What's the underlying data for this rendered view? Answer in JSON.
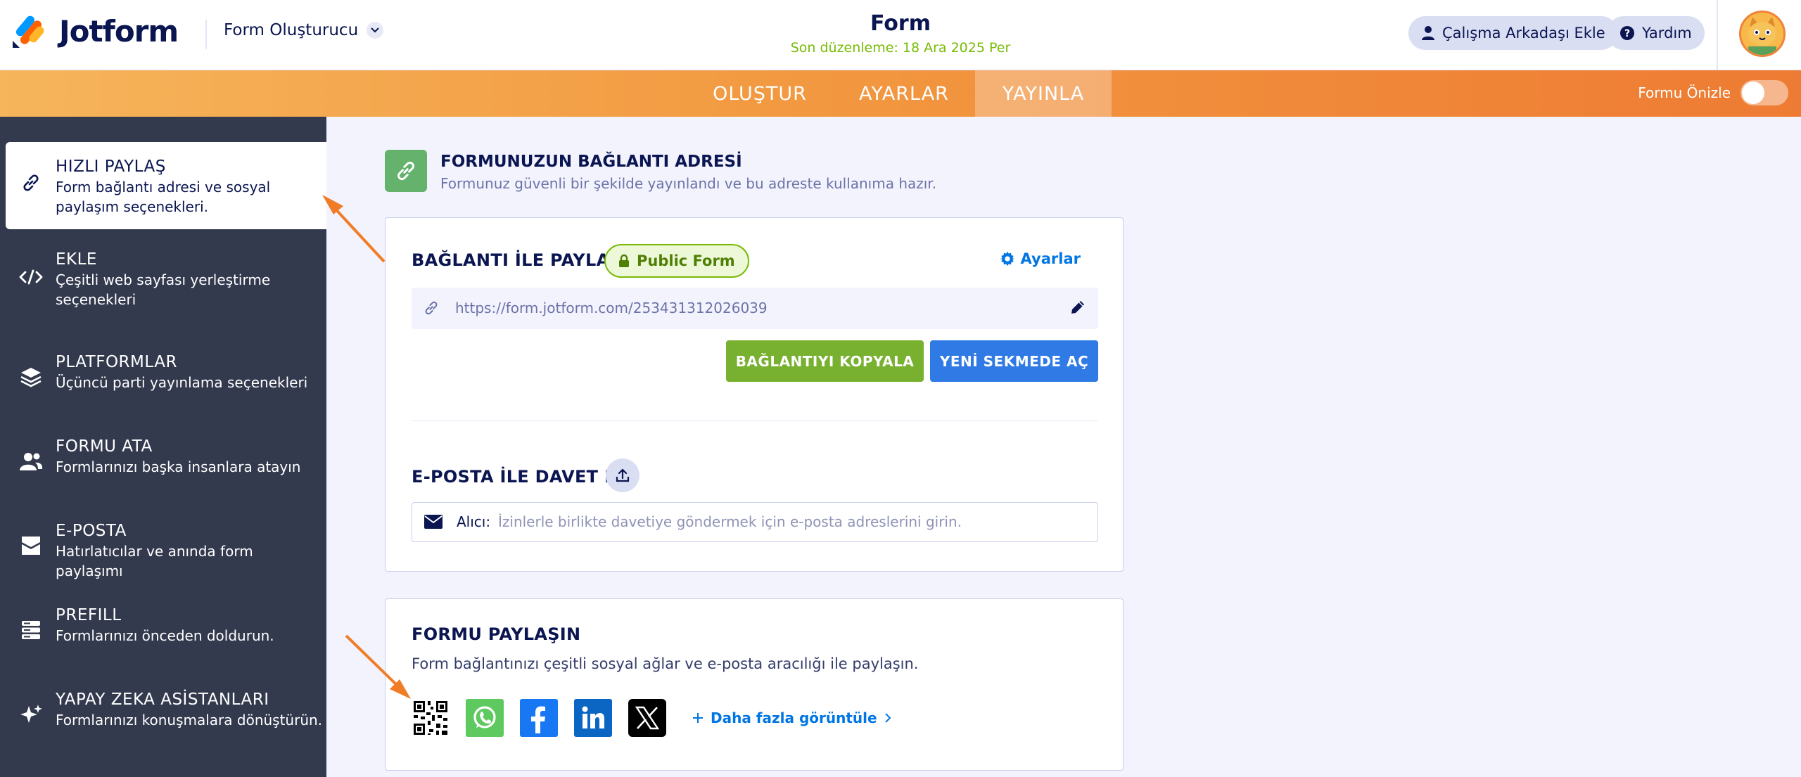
{
  "header": {
    "brand": "Jotform",
    "builder_label": "Form Oluşturucu",
    "form_title": "Form",
    "last_edited": "Son düzenleme: 18 Ara 2025 Per",
    "add_collaborator": "Çalışma Arkadaşı Ekle",
    "help": "Yardım"
  },
  "nav": {
    "tabs": [
      {
        "label": "OLUŞTUR"
      },
      {
        "label": "AYARLAR"
      },
      {
        "label": "YAYINLA"
      }
    ],
    "preview_label": "Formu Önizle"
  },
  "sidebar": {
    "items": [
      {
        "title": "HIZLI PAYLAŞ",
        "desc": "Form bağlantı adresi ve sosyal paylaşım seçenekleri.",
        "icon": "link-icon"
      },
      {
        "title": "EKLE",
        "desc": "Çeşitli web sayfası yerleştirme seçenekleri",
        "icon": "code-icon"
      },
      {
        "title": "PLATFORMLAR",
        "desc": "Üçüncü parti yayınlama seçenekleri",
        "icon": "layers-icon"
      },
      {
        "title": "FORMU ATA",
        "desc": "Formlarınızı başka insanlara atayın",
        "icon": "users-icon"
      },
      {
        "title": "E-POSTA",
        "desc": "Hatırlatıcılar ve anında form paylaşımı",
        "icon": "mail-icon"
      },
      {
        "title": "PREFILL",
        "desc": "Formlarınızı önceden doldurun.",
        "icon": "prefill-icon"
      },
      {
        "title": "YAPAY ZEKA ASİSTANLARI",
        "desc": "Formlarınızı konuşmalara dönüştürün.",
        "icon": "sparkle-icon"
      }
    ]
  },
  "link_section": {
    "title": "FORMUNUZUN BAĞLANTI ADRESİ",
    "subtitle": "Formunuz güvenli bir şekilde yayınlandı ve bu adreste kullanıma hazır."
  },
  "share_card": {
    "title": "BAĞLANTI İLE PAYLAŞ",
    "badge": "Public Form",
    "settings": "Ayarlar",
    "url": "https://form.jotform.com/253431312026039",
    "copy_button": "BAĞLANTIYI KOPYALA",
    "open_button": "YENİ SEKMEDE AÇ",
    "invite_title": "E-POSTA İLE DAVET ET",
    "recipient_label": "Alıcı:",
    "recipient_placeholder": "İzinlerle birlikte davetiye göndermek için e-posta adreslerini girin."
  },
  "social_card": {
    "title": "FORMU PAYLAŞIN",
    "desc": "Form bağlantınızı çeşitli sosyal ağlar ve e-posta aracılığı ile paylaşın.",
    "icons": [
      "qr-code-icon",
      "whatsapp-icon",
      "facebook-icon",
      "linkedin-icon",
      "x-icon"
    ],
    "more": "Daha fazla görüntüle"
  },
  "colors": {
    "accent_orange": "#f29840",
    "sidebar_bg": "#333a4e",
    "green": "#78b030",
    "blue": "#2f7ae5"
  }
}
